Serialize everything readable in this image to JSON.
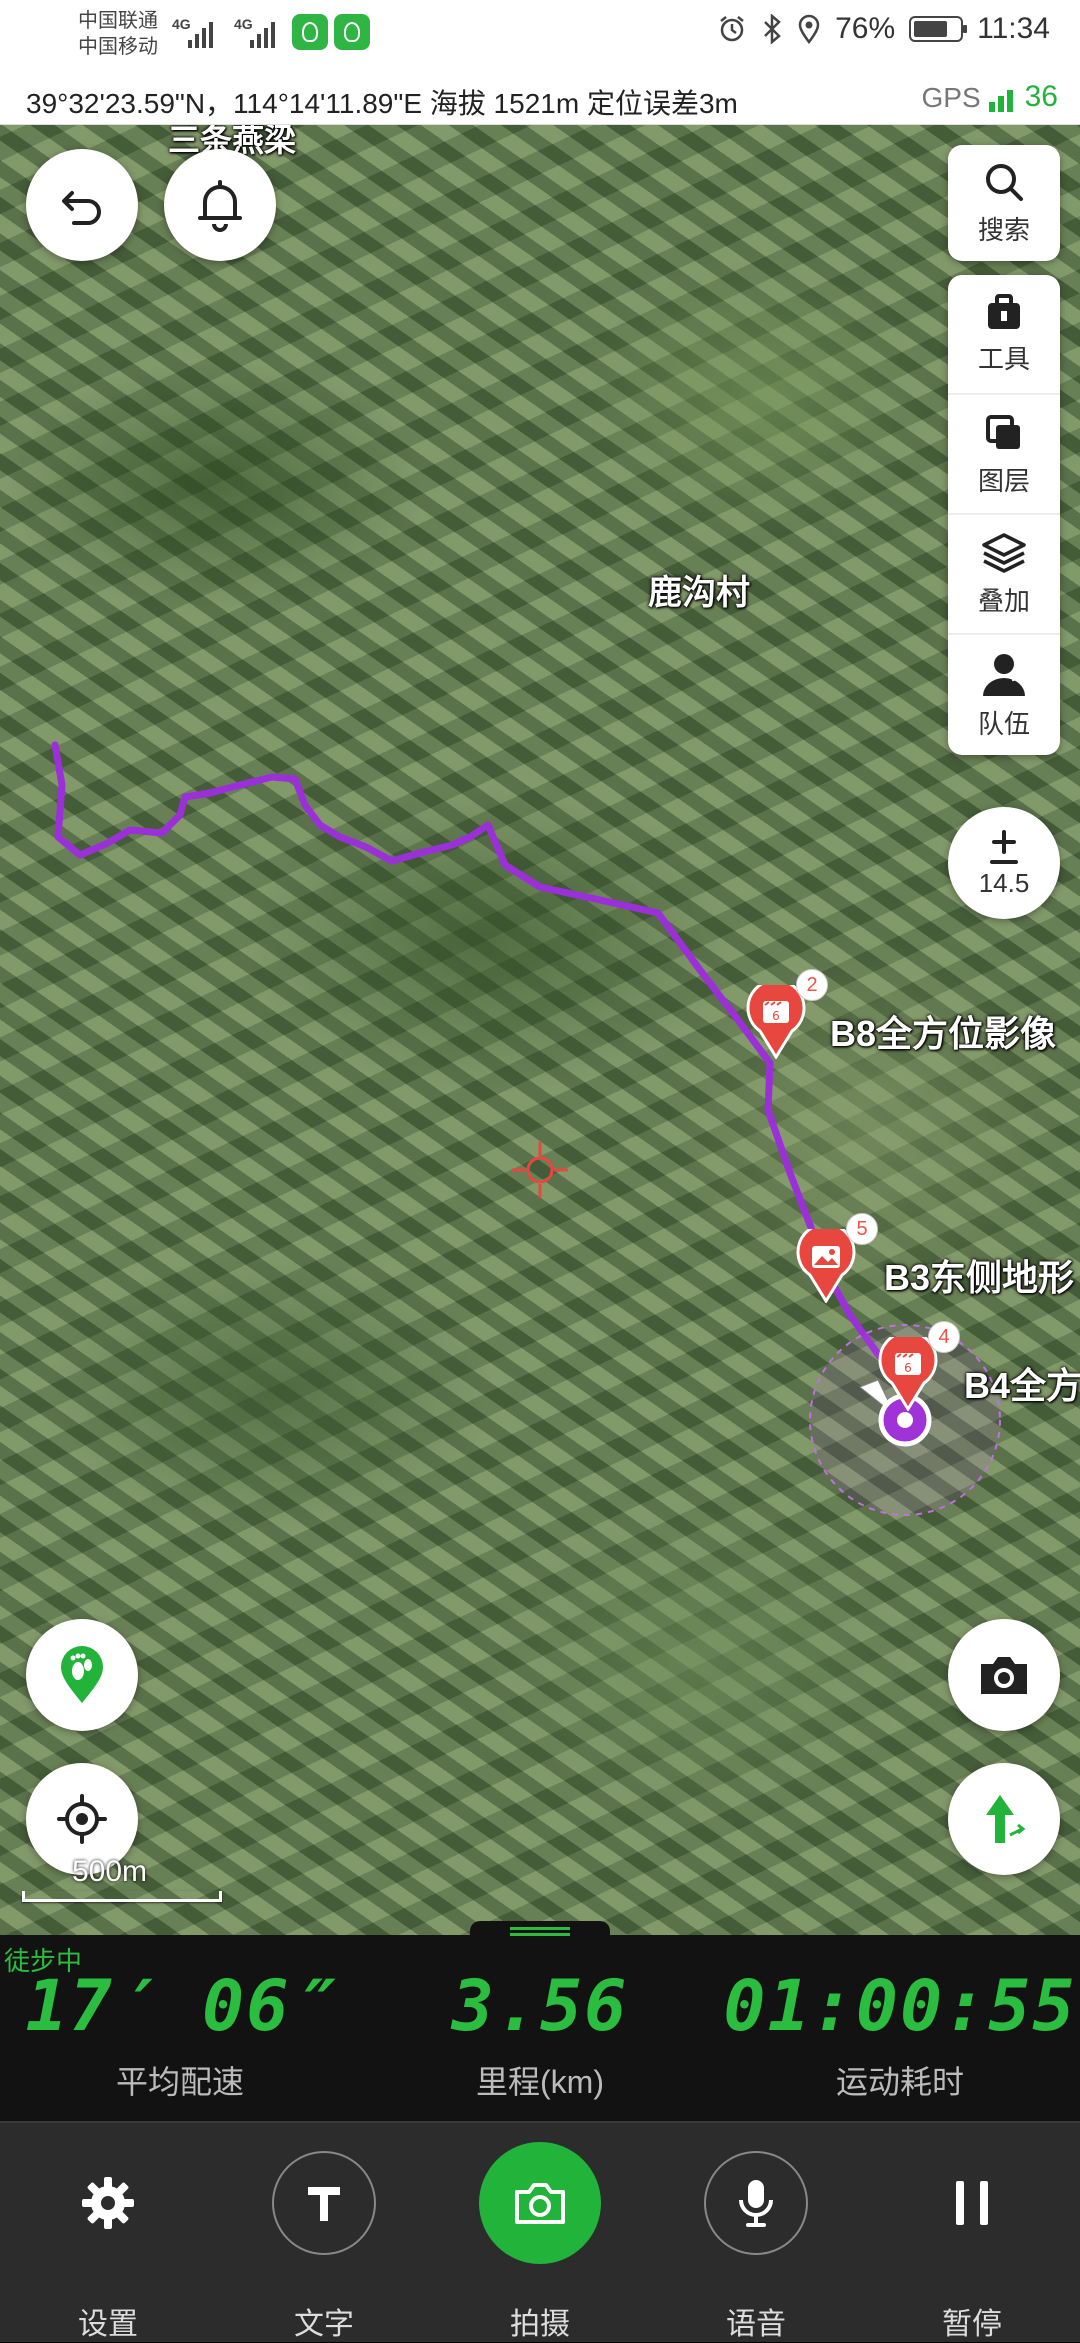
{
  "status_bar": {
    "carrier_1": "中国联通",
    "carrier_2": "中国移动",
    "net_1": "4G",
    "net_2": "4G",
    "battery_percent": "76%",
    "battery_level": 0.76,
    "time": "11:34"
  },
  "location_bar": {
    "coordinates": "39°32'23.59\"N，114°14'11.89\"E  海拔 1521m  定位误差3m",
    "gps_label": "GPS",
    "satellites": "36"
  },
  "map": {
    "top_partial_label": "三条燕梁",
    "village_label": "鹿沟村",
    "markers": [
      {
        "badge": "2",
        "label": "B8全方位影像",
        "icon": "video-marker-icon"
      },
      {
        "badge": "5",
        "label": "B3东侧地形",
        "icon": "photo-marker-icon"
      },
      {
        "badge": "4",
        "label": "B4全方",
        "icon": "video-marker-icon"
      }
    ],
    "zoom_level": "14.5",
    "scale_label": "500m",
    "track_color": "#9b30d9",
    "marker_color": "#e8473f"
  },
  "right_panel": {
    "search_label": "搜索",
    "items": [
      {
        "label": "工具",
        "icon": "toolbox-icon"
      },
      {
        "label": "图层",
        "icon": "layers-copy-icon"
      },
      {
        "label": "叠加",
        "icon": "overlay-stack-icon"
      },
      {
        "label": "队伍",
        "icon": "team-person-icon"
      }
    ]
  },
  "stats": {
    "status": "徒步中",
    "pace_value": "17′ 06″",
    "pace_label": "平均配速",
    "distance_value": "3.56",
    "distance_label": "里程(km)",
    "duration_value": "01:00:55",
    "duration_label": "运动耗时",
    "accent_color": "#2bbd3f"
  },
  "toolbar": {
    "settings_label": "设置",
    "text_label": "文字",
    "capture_label": "拍摄",
    "voice_label": "语音",
    "pause_label": "暂停"
  }
}
